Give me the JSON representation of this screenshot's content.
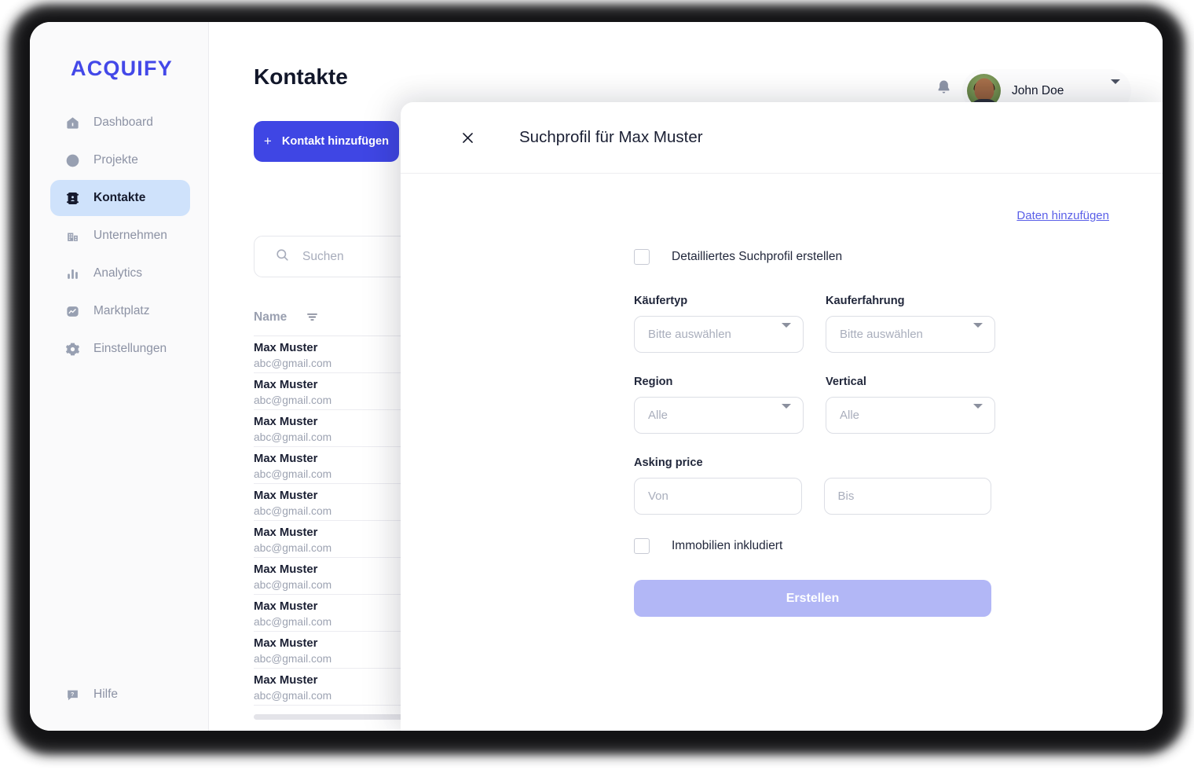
{
  "brand": {
    "logo": "ACQUIFY",
    "accent": "#4348e8"
  },
  "sidebar": {
    "items": [
      {
        "label": "Dashboard",
        "icon": "home-icon",
        "active": false
      },
      {
        "label": "Projekte",
        "icon": "check-circle-icon",
        "active": false
      },
      {
        "label": "Kontakte",
        "icon": "contact-card-icon",
        "active": true
      },
      {
        "label": "Unternehmen",
        "icon": "building-icon",
        "active": false
      },
      {
        "label": "Analytics",
        "icon": "bar-chart-icon",
        "active": false
      },
      {
        "label": "Marktplatz",
        "icon": "trend-square-icon",
        "active": false
      },
      {
        "label": "Einstellungen",
        "icon": "gear-icon",
        "active": false
      }
    ],
    "help": {
      "label": "Hilfe",
      "icon": "help-bubble-icon"
    }
  },
  "header": {
    "title": "Kontakte",
    "notifications_icon": "bell-icon",
    "user": {
      "name": "John Doe",
      "avatar": "user-photo-avatar",
      "caret": "chevron-down-icon"
    }
  },
  "toolbar": {
    "add_contact_label": "Kontakt hinzufügen",
    "add_contact_plus": "+"
  },
  "search": {
    "placeholder": "Suchen",
    "icon": "search-icon"
  },
  "table": {
    "columns": [
      "Name"
    ],
    "filter_icon": "filter-icon",
    "rows": [
      {
        "name": "Max Muster",
        "email": "abc@gmail.com"
      },
      {
        "name": "Max Muster",
        "email": "abc@gmail.com"
      },
      {
        "name": "Max Muster",
        "email": "abc@gmail.com"
      },
      {
        "name": "Max Muster",
        "email": "abc@gmail.com"
      },
      {
        "name": "Max Muster",
        "email": "abc@gmail.com"
      },
      {
        "name": "Max Muster",
        "email": "abc@gmail.com"
      },
      {
        "name": "Max Muster",
        "email": "abc@gmail.com"
      },
      {
        "name": "Max Muster",
        "email": "abc@gmail.com"
      },
      {
        "name": "Max Muster",
        "email": "abc@gmail.com"
      },
      {
        "name": "Max Muster",
        "email": "abc@gmail.com"
      }
    ]
  },
  "modal": {
    "title": "Suchprofil für Max Muster",
    "close_icon": "close-icon",
    "add_data_link": "Daten hinzufügen",
    "detailed_checkbox_label": "Detailliertes Suchprofil erstellen",
    "fields": {
      "buyer_type": {
        "label": "Käufertyp",
        "value": "Bitte auswählen"
      },
      "buyer_experience": {
        "label": "Kauferfahrung",
        "value": "Bitte auswählen"
      },
      "region": {
        "label": "Region",
        "value": "Alle"
      },
      "vertical": {
        "label": "Vertical",
        "value": "Alle"
      },
      "asking_price": {
        "label": "Asking price",
        "from_placeholder": "Von",
        "to_placeholder": "Bis"
      }
    },
    "real_estate_checkbox_label": "Immobilien inkludiert",
    "submit_label": "Erstellen",
    "submit_color": "#b2b7f6"
  }
}
